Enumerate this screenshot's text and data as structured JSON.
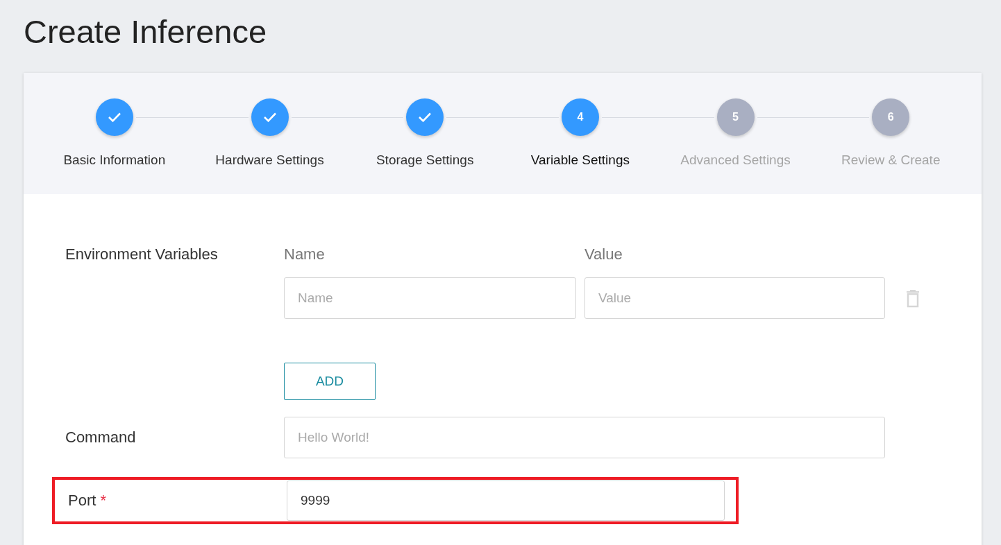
{
  "page": {
    "title": "Create Inference"
  },
  "steps": [
    {
      "label": "Basic Information",
      "completed": true,
      "selected": false
    },
    {
      "label": "Hardware Settings",
      "completed": true,
      "selected": false
    },
    {
      "label": "Storage Settings",
      "completed": true,
      "selected": false
    },
    {
      "number": "4",
      "label": "Variable Settings",
      "completed": false,
      "selected": true
    },
    {
      "number": "5",
      "label": "Advanced Settings",
      "completed": false,
      "selected": false
    },
    {
      "number": "6",
      "label": "Review & Create",
      "completed": false,
      "selected": false
    }
  ],
  "env": {
    "label": "Environment Variables",
    "name_header": "Name",
    "value_header": "Value",
    "rows": [
      {
        "name_placeholder": "Name",
        "value_placeholder": "Value"
      }
    ],
    "add_button": "ADD"
  },
  "command": {
    "label": "Command",
    "placeholder": "Hello World!"
  },
  "port": {
    "label": "Port",
    "required_mark": "*",
    "required": true,
    "value": "9999",
    "highlighted": true
  }
}
